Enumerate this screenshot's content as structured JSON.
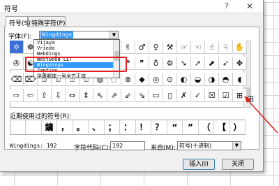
{
  "dialog": {
    "title": "符号",
    "help": "?",
    "close": "✕"
  },
  "tabs": [
    "符号(S)",
    "特殊字符(P)"
  ],
  "font": {
    "label": "字体(F):",
    "value": "Wingdings",
    "options": [
      "Vijaya",
      "Vrinda",
      "Webdings",
      "Westwood LET",
      "Wingdings",
      "Zapfino",
      "华康郷体一号全方正体"
    ],
    "selected_index": 4
  },
  "grid": {
    "rows": [
      [
        "✡",
        "☸",
        "✧",
        "✂",
        "✁",
        "⌛",
        "⌚",
        "🖐",
        "✌",
        "♂",
        "♀",
        "⚒",
        "☞",
        "☜",
        "☝",
        "☟",
        "✋",
        "☺",
        "☹",
        "✈"
      ],
      [
        "✇",
        "☯",
        "⚑",
        "✍",
        "⚐",
        "✎",
        "✏",
        "✑",
        "❝",
        "❞",
        "♁",
        "⚙",
        "➘",
        "➚",
        "⬈",
        "➶",
        "✥",
        "✴",
        "✲",
        "✿"
      ],
      [
        "⌫",
        "⌦",
        "⍈",
        "⍇",
        "⍐",
        "⍗",
        "◍",
        "◌",
        "⊗",
        "◆",
        "◎",
        "⊙",
        "◐",
        "◒",
        "◑",
        "◓",
        "◖",
        "◗",
        "◚",
        "◛"
      ],
      [
        "⇨",
        "⇦",
        "⇧",
        "⇩",
        "⇔",
        "⇕",
        "⇖",
        "⇗",
        "⇙",
        "⇘",
        "▭",
        "▯",
        "✗",
        "✓",
        "☒",
        "☑",
        "⊞",
        "⊟",
        "⊠",
        "⊡"
      ]
    ],
    "selected_row": 0,
    "selected_col": 0,
    "grid_mark": "田"
  },
  "recent": {
    "label": "近期使用过的符号(R):",
    "symbols": [
      "",
      "",
      "鏞",
      "，",
      "。",
      "、",
      "；",
      "：",
      "！",
      "？",
      "“",
      "”",
      "（",
      "【",
      "）"
    ]
  },
  "info": {
    "font_code_text": "Wingdings: 192",
    "char_code_label": "字符代码(C):",
    "char_code_value": "192",
    "from_label": "来自(M):",
    "from_value": "符号(十进制)"
  },
  "buttons": {
    "insert": "插入(I)",
    "close": "关闭"
  },
  "colors": {
    "highlight": "#e02020",
    "selection": "#3399ff"
  }
}
